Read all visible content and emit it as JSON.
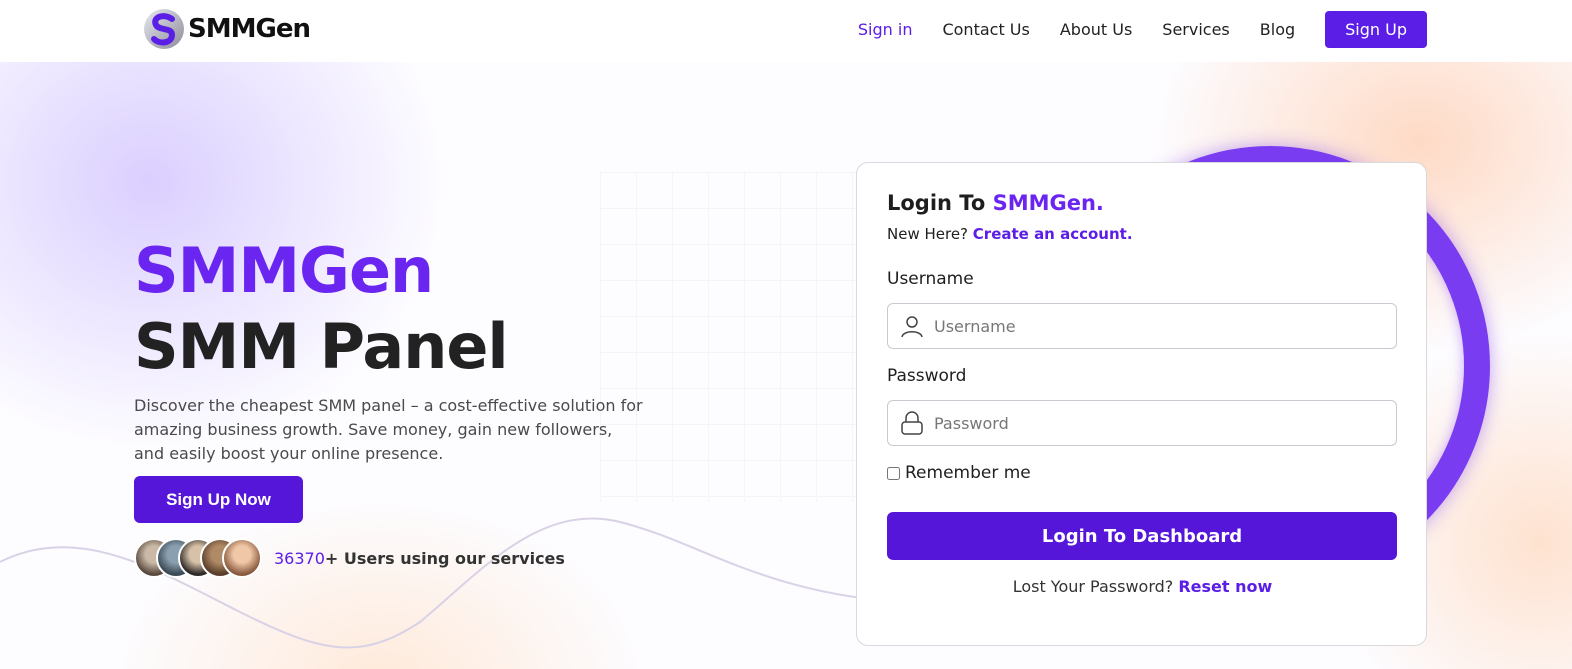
{
  "header": {
    "logo_text": "SMMGen",
    "nav": [
      {
        "label": "Sign in",
        "active": true
      },
      {
        "label": "Contact Us",
        "active": false
      },
      {
        "label": "About Us",
        "active": false
      },
      {
        "label": "Services",
        "active": false
      },
      {
        "label": "Blog",
        "active": false
      }
    ],
    "signup_label": "Sign Up"
  },
  "hero": {
    "title_line1": "SMMGen",
    "title_line2": "SMM Panel",
    "description": "Discover the cheapest SMM panel – a cost-effective solution for amazing business growth. Save money, gain new followers, and easily boost your online presence.",
    "cta_label": "Sign Up Now",
    "users_count": "36370",
    "users_suffix": "+ Users using our services"
  },
  "login": {
    "title_prefix": "Login To ",
    "title_brand": "SMMGen.",
    "new_here": "New Here? ",
    "create_account": "Create an account.",
    "username_label": "Username",
    "username_placeholder": "Username",
    "password_label": "Password",
    "password_placeholder": "Password",
    "remember_label": "Remember me",
    "submit_label": "Login To Dashboard",
    "lost_password": "Lost Your Password? ",
    "reset_link": "Reset now"
  },
  "colors": {
    "accent": "#5b1ee6",
    "brand_purple": "#6a25f0",
    "button": "#5516da"
  }
}
